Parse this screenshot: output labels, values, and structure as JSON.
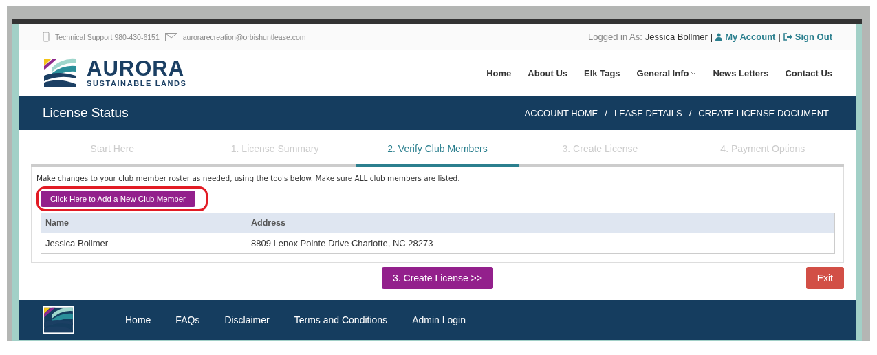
{
  "top_bar": {
    "support": "Technical Support 980-430-6151",
    "email": "aurorarecreation@orbishuntlease.com",
    "logged_in_label": "Logged in As:",
    "user": "Jessica Bollmer",
    "separator_1": "|",
    "account_link": "My Account",
    "separator_2": "|",
    "sign_out_link": "Sign Out"
  },
  "logo": {
    "name": "AURORA",
    "tagline": "SUSTAINABLE LANDS"
  },
  "nav": [
    {
      "label": "Home",
      "dropdown": false
    },
    {
      "label": "About Us",
      "dropdown": false
    },
    {
      "label": "Elk Tags",
      "dropdown": false
    },
    {
      "label": "General Info",
      "dropdown": true
    },
    {
      "label": "News Letters",
      "dropdown": false
    },
    {
      "label": "Contact Us",
      "dropdown": false
    }
  ],
  "title_bar": {
    "title": "License Status",
    "breadcrumbs": [
      "ACCOUNT HOME",
      "LEASE DETAILS",
      "CREATE LICENSE DOCUMENT"
    ],
    "separator": "/"
  },
  "tabs": [
    {
      "label": "Start Here",
      "selected": false
    },
    {
      "label": "1. License Summary",
      "selected": false
    },
    {
      "label": "2. Verify Club Members",
      "selected": true
    },
    {
      "label": "3. Create License",
      "selected": false
    },
    {
      "label": "4. Payment Options",
      "selected": false
    }
  ],
  "message": {
    "before": "Make changes to your club member roster as needed, using the tools below. Make sure ",
    "underlined": "ALL",
    "after": " club members are listed."
  },
  "add_button": {
    "label": "Click Here to Add a New Club Member",
    "highlighted": true
  },
  "table": {
    "columns": [
      "Name",
      "Address"
    ],
    "rows": [
      [
        "Jessica Bollmer",
        "8809 Lenox Pointe Drive Charlotte, NC 28273"
      ]
    ]
  },
  "actions": {
    "next": "3. Create License >>",
    "exit": "Exit"
  },
  "footer": {
    "links": [
      "Home",
      "FAQs",
      "Disclaimer",
      "Terms and Conditions",
      "Admin Login"
    ]
  }
}
